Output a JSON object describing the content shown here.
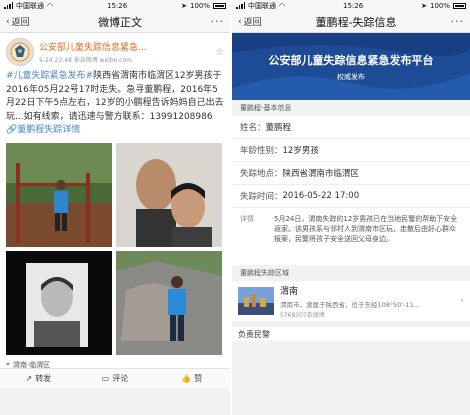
{
  "left": {
    "status": {
      "carrier": "中国联通",
      "time": "15:26",
      "battery": "100%"
    },
    "nav": {
      "back": "返回",
      "title": "微博正文",
      "more": "···"
    },
    "author": {
      "name": "公安部儿童失踪信息紧急...",
      "meta": "5-24 23:48 来自微博 weibo.com"
    },
    "post": {
      "hashtag": "#儿童失踪紧急发布#",
      "body": "陕西省渭南市临渭区12岁男孩于2016年05月22号17时走失。急寻董鹏程，2016年5月22日下午5点左右，12岁的小鹏程告诉妈妈自己出去玩...如有线索，请迅速与警方联系：",
      "phone": "13991208986",
      "link": "董鹏程失踪详情"
    },
    "location": "渭南·临渭区",
    "actions": {
      "repost": "转发",
      "comment": "评论",
      "like": "赞"
    }
  },
  "right": {
    "status": {
      "carrier": "中国联通",
      "time": "15:26",
      "battery": "100%"
    },
    "nav": {
      "back": "返回",
      "title": "董鹏程-失踪信息",
      "more": "···"
    },
    "banner": {
      "title": "公安部儿童失踪信息紧急发布平台",
      "subtitle": "权威发布"
    },
    "basic_header": "董鹏程-基本信息",
    "fields": {
      "name": {
        "label": "姓名：",
        "value": "董鹏程"
      },
      "desc": {
        "label": "年龄性别：",
        "value": "12岁男孩"
      },
      "place": {
        "label": "失踪地点：",
        "value": "陕西省渭南市临渭区"
      },
      "time": {
        "label": "失踪时间：",
        "value": "2016-05-22 17:00"
      }
    },
    "details": {
      "label": "详情",
      "text": "5月24日，渭南失踪的12岁男孩已在当地民警的帮助下安全返家。该男孩系与邻村人到渭南市区玩，走散后由好心群众报案，民警将孩子安全送回父母身边。"
    },
    "area_header": "董鹏程失踪区域",
    "area": {
      "name": "渭南",
      "desc": "渭南市，隶属于陕西省，位于东经108°50'-11...",
      "meta": "5768307条微博"
    },
    "bottom_label": "负责民警"
  }
}
